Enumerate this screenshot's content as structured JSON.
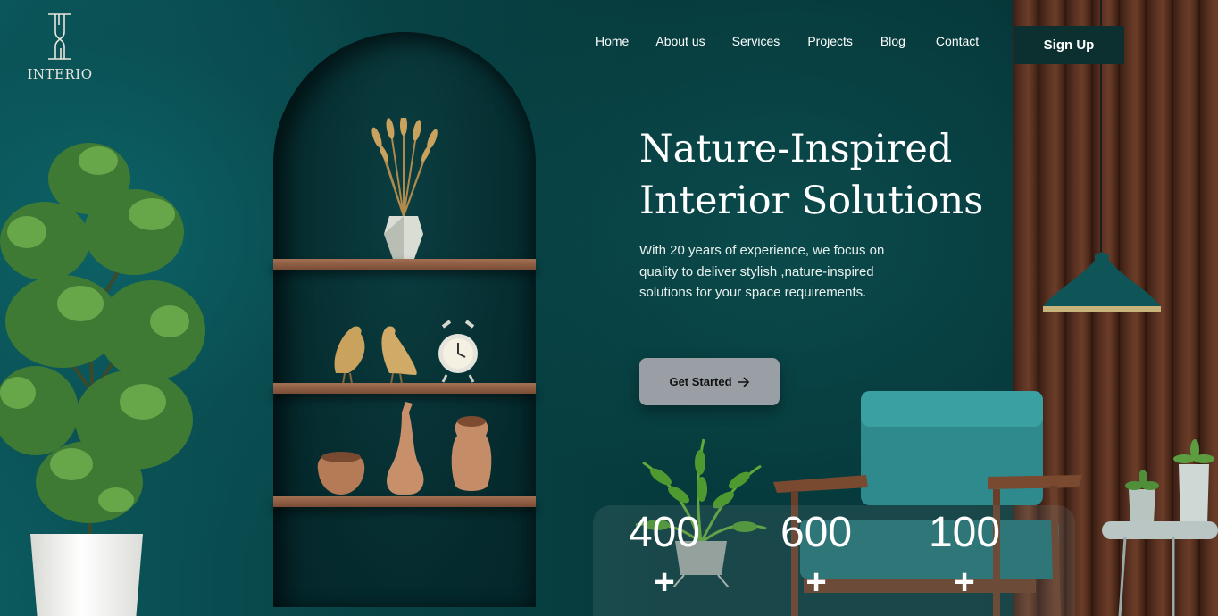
{
  "brand": {
    "name": "INTERIO",
    "logo_icon": "interio-monogram-icon"
  },
  "nav": {
    "items": [
      {
        "label": "Home"
      },
      {
        "label": "About us"
      },
      {
        "label": "Services"
      },
      {
        "label": "Projects"
      },
      {
        "label": "Blog"
      },
      {
        "label": "Contact"
      }
    ],
    "signup_label": "Sign Up"
  },
  "hero": {
    "title_line1": "Nature-Inspired",
    "title_line2": "Interior Solutions",
    "subtitle_line1": "With 20 years of experience, we focus on",
    "subtitle_line2": "quality to deliver stylish ,nature-inspired",
    "subtitle_line3": "solutions for your space requirements.",
    "cta_label": "Get Started",
    "cta_icon": "arrow-right-icon"
  },
  "stats": [
    {
      "value": "400",
      "suffix": "+"
    },
    {
      "value": "600",
      "suffix": "+"
    },
    {
      "value": "100",
      "suffix": "+"
    }
  ],
  "colors": {
    "background": "#084346",
    "signup_bg": "#0b302f",
    "cta_bg": "#9a9fa5",
    "text": "#ffffff"
  }
}
